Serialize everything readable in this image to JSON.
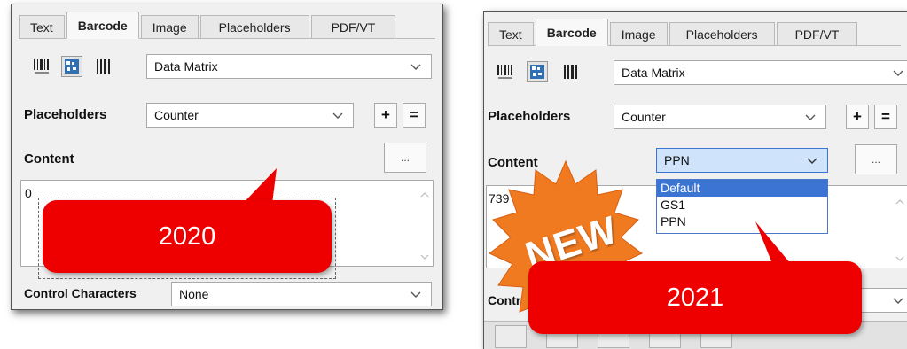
{
  "tabs": [
    "Text",
    "Barcode",
    "Image",
    "Placeholders",
    "PDF/VT"
  ],
  "left_panel": {
    "barcode_type": "Data Matrix",
    "placeholders_label": "Placeholders",
    "placeholders_value": "Counter",
    "plus_label": "+",
    "equals_label": "=",
    "content_label": "Content",
    "dots_label": "...",
    "content_text": "0",
    "control_chars_label": "Control Characters",
    "control_chars_value": "None",
    "callout_text": "2020"
  },
  "right_panel": {
    "barcode_type": "Data Matrix",
    "placeholders_label": "Placeholders",
    "placeholders_value": "Counter",
    "plus_label": "+",
    "equals_label": "=",
    "content_label": "Content",
    "mode_value": "PPN",
    "mode_options": [
      "Default",
      "GS1",
      "PPN"
    ],
    "dots_label": "...",
    "content_text": "739",
    "control_partial_label": "Contr",
    "badge_text": "NEW",
    "callout_text": "2021"
  },
  "colors": {
    "callout": "#ee0000",
    "badge": "#f07a20",
    "selection": "#3b74d3",
    "combo_active": "#cfe4fb"
  }
}
